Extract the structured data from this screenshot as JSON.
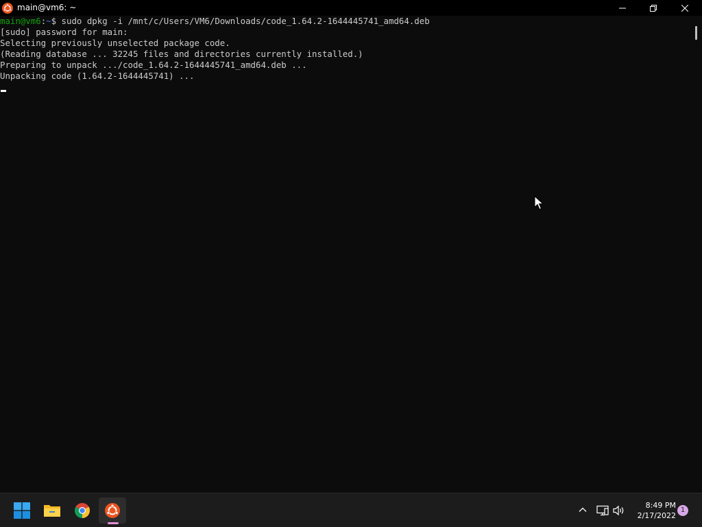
{
  "window": {
    "title": "main@vm6: ~",
    "icon": "ubuntu-icon",
    "controls": {
      "minimize": "minimize-icon",
      "maximize": "restore-icon",
      "close": "close-icon"
    }
  },
  "terminal": {
    "prompt": {
      "user": "main@vm6",
      "separator": ":",
      "path": "~",
      "symbol": "$",
      "command": " sudo dpkg -i /mnt/c/Users/VM6/Downloads/code_1.64.2-1644445741_amd64.deb"
    },
    "output": [
      "[sudo] password for main:",
      "Selecting previously unselected package code.",
      "(Reading database ... 32245 files and directories currently installed.)",
      "Preparing to unpack .../code_1.64.2-1644445741_amd64.deb ...",
      "Unpacking code (1.64.2-1644445741) ..."
    ]
  },
  "taskbar": {
    "apps": [
      {
        "name": "Start",
        "icon": "windows-start-icon"
      },
      {
        "name": "File Explorer",
        "icon": "folder-icon"
      },
      {
        "name": "Google Chrome",
        "icon": "chrome-icon"
      },
      {
        "name": "Ubuntu",
        "icon": "ubuntu-icon",
        "active": true
      }
    ],
    "tray": {
      "icons": [
        "chevron-up-icon",
        "network-icon",
        "volume-icon"
      ]
    },
    "clock": {
      "time": "8:49 PM",
      "date": "2/17/2022"
    },
    "notification_count": "1"
  },
  "colors": {
    "terminal_bg": "#0c0c0c",
    "terminal_text": "#cccccc",
    "prompt_user": "#13a10e",
    "prompt_path": "#3b78ff",
    "ubuntu_orange": "#e95420",
    "taskbar_bg": "#1c1c1c",
    "active_indicator": "#e58ed6"
  }
}
